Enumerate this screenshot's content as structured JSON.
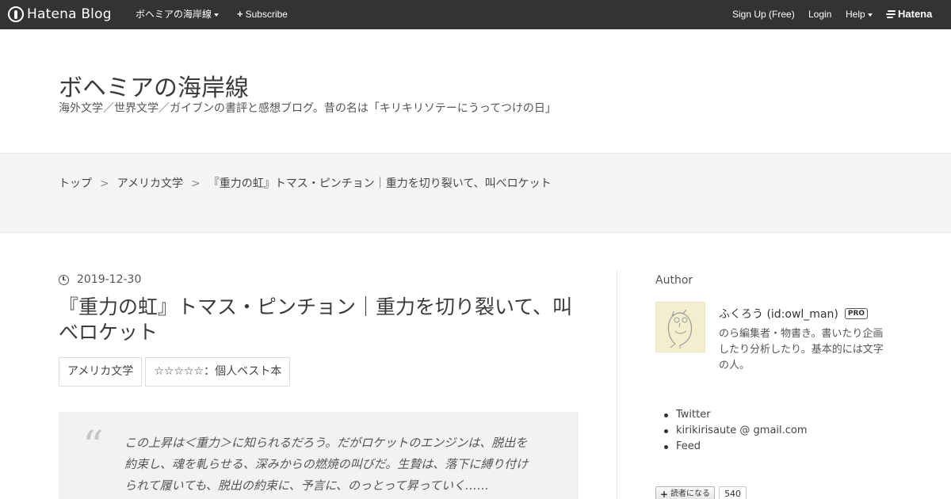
{
  "globalbar": {
    "logo_text": "Hatena Blog",
    "blog_menu_label": "ボヘミアの海岸線",
    "subscribe_label": "Subscribe",
    "signup_label": "Sign Up (Free)",
    "login_label": "Login",
    "help_label": "Help",
    "brand_label": "Hatena"
  },
  "blog": {
    "title": "ボヘミアの海岸線",
    "description": "海外文学／世界文学／ガイブンの書評と感想ブログ。昔の名は「キリキリソテーにうってつけの日」"
  },
  "breadcrumb": {
    "items": [
      "トップ",
      "アメリカ文学",
      "『重力の虹』トマス・ピンチョン｜重力を切り裂いて、叫べロケット"
    ],
    "separator": ">"
  },
  "entry": {
    "date": "2019-12-30",
    "title": "『重力の虹』トマス・ピンチョン｜重力を切り裂いて、叫べロケット",
    "categories": [
      "アメリカ文学",
      "☆☆☆☆☆：個人ベスト本"
    ],
    "quote_mark": "“",
    "quote_lines": [
      "この上昇は＜重力＞に知られるだろう。だがロケットのエンジンは、脱出を",
      "約束し、魂を軋らせる、深みからの燃焼の叫びだ。生贄は、落下に縛り付け",
      "られて履いても、脱出の約束に、予言に、のっとって昇っていく……"
    ]
  },
  "sidebar": {
    "heading": "Author",
    "author_name": "ふくろう (id:owl_man)",
    "pro_badge": "PRO",
    "author_desc": "のら編集者・物書き。書いたり企画したり分析したり。基本的には文字の人。",
    "links": [
      "Twitter",
      "kirikirisaute @ gmail.com",
      "Feed"
    ],
    "subscribe_label": "読者になる",
    "subscriber_count": "540"
  },
  "colors": {
    "topbar": "#333333",
    "breadcrumb_band": "#f5f5f5",
    "quote_bg": "#f2f2f2",
    "avatar_bg": "#f3eecd"
  },
  "icons": [
    "hatena-blog-logo-icon",
    "caret-down-icon",
    "plus-icon",
    "hatena-logo-icon",
    "clock-icon",
    "owl-avatar-icon"
  ]
}
